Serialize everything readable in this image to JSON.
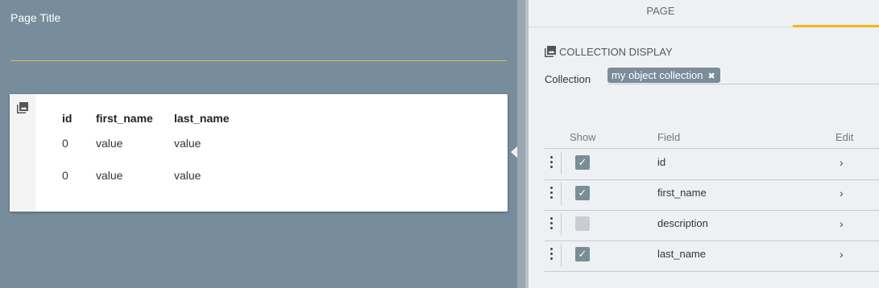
{
  "canvas": {
    "page_title": "Page Title",
    "table": {
      "headers": [
        "id",
        "first_name",
        "last_name"
      ],
      "rows": [
        [
          "0",
          "value",
          "value"
        ],
        [
          "0",
          "value",
          "value"
        ]
      ]
    }
  },
  "panel": {
    "tabs": {
      "page_label": "PAGE"
    },
    "section_title": "COLLECTION DISPLAY",
    "collection_label": "Collection",
    "collection_chip": "my object collection",
    "chip_remove": "✖",
    "columns": {
      "show": "Show",
      "field": "Field",
      "edit": "Edit"
    },
    "fields": [
      {
        "name": "id",
        "checked": true,
        "check": "✓"
      },
      {
        "name": "first_name",
        "checked": true,
        "check": "✓"
      },
      {
        "name": "description",
        "checked": false,
        "check": ""
      },
      {
        "name": "last_name",
        "checked": true,
        "check": "✓"
      }
    ],
    "chevron": "›"
  },
  "colors": {
    "canvas_bg": "#778d9b",
    "accent": "#f2b818",
    "chip_bg": "#7a8d98",
    "panel_bg": "#eef1f3"
  }
}
